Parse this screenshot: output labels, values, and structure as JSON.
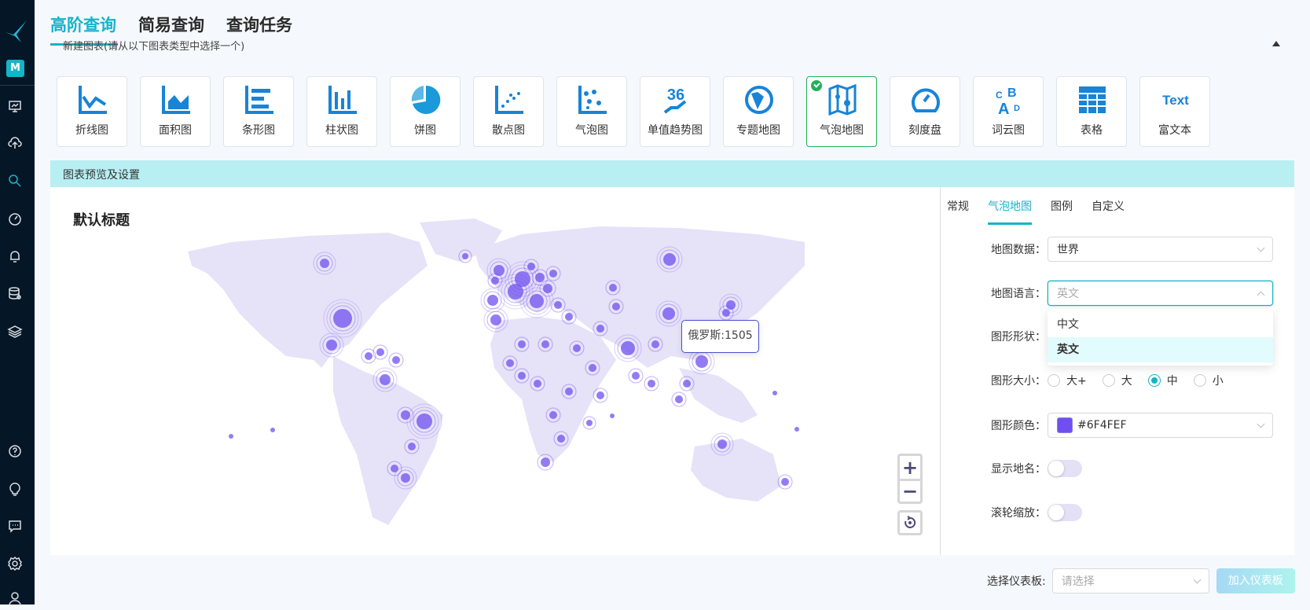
{
  "sidebar": {
    "badge": "M",
    "items": [
      {
        "name": "dashboard-icon"
      },
      {
        "name": "upload-cloud-icon"
      },
      {
        "name": "search-icon",
        "active": true
      },
      {
        "name": "gauge-icon"
      },
      {
        "name": "bell-icon"
      },
      {
        "name": "database-icon"
      },
      {
        "name": "layers-icon"
      }
    ],
    "bottom": [
      {
        "name": "help-icon"
      },
      {
        "name": "lightbulb-icon"
      },
      {
        "name": "message-icon"
      },
      {
        "name": "settings-icon"
      },
      {
        "name": "user-icon"
      }
    ]
  },
  "topnav": {
    "tabs": [
      {
        "label": "高阶查询",
        "active": true
      },
      {
        "label": "简易查询"
      },
      {
        "label": "查询任务"
      }
    ]
  },
  "subtitle": "新建图表(请从以下图表类型中选择一个)",
  "chart_types": [
    {
      "label": "折线图",
      "icon": "line-chart-icon"
    },
    {
      "label": "面积图",
      "icon": "area-chart-icon"
    },
    {
      "label": "条形图",
      "icon": "bar-chart-icon"
    },
    {
      "label": "柱状图",
      "icon": "column-chart-icon"
    },
    {
      "label": "饼图",
      "icon": "pie-chart-icon"
    },
    {
      "label": "散点图",
      "icon": "scatter-chart-icon"
    },
    {
      "label": "气泡图",
      "icon": "bubble-chart-icon"
    },
    {
      "label": "单值趋势图",
      "icon": "single-value-trend-icon",
      "icon_text": "36"
    },
    {
      "label": "专题地图",
      "icon": "globe-icon"
    },
    {
      "label": "气泡地图",
      "icon": "bubble-map-icon",
      "selected": true
    },
    {
      "label": "刻度盘",
      "icon": "gauge-chart-icon"
    },
    {
      "label": "词云图",
      "icon": "word-cloud-icon"
    },
    {
      "label": "表格",
      "icon": "table-icon"
    },
    {
      "label": "富文本",
      "icon": "rich-text-icon",
      "icon_text": "Text"
    }
  ],
  "preview": {
    "header": "图表预览及设置",
    "chart_title": "默认标题",
    "tooltip": "俄罗斯:1505",
    "bubble_color": "#6F4FEF"
  },
  "settings": {
    "tabs": [
      {
        "label": "常规"
      },
      {
        "label": "气泡地图",
        "active": true
      },
      {
        "label": "图例"
      },
      {
        "label": "自定义"
      }
    ],
    "map_data": {
      "label": "地图数据：",
      "value": "世界"
    },
    "map_language": {
      "label": "地图语言：",
      "placeholder": "英文",
      "options": [
        "中文",
        "英文"
      ],
      "selected": "英文"
    },
    "shape": {
      "label": "图形形状："
    },
    "size": {
      "label": "图形大小：",
      "options": [
        "大+",
        "大",
        "中",
        "小"
      ],
      "selected": "中"
    },
    "color": {
      "label": "图形颜色：",
      "value": "#6F4FEF"
    },
    "show_names": {
      "label": "显示地名：",
      "on": false
    },
    "wheel_zoom": {
      "label": "滚轮缩放：",
      "on": false
    }
  },
  "footer": {
    "label": "选择仪表板:",
    "placeholder": "请选择",
    "add_button": "加入仪表板"
  }
}
